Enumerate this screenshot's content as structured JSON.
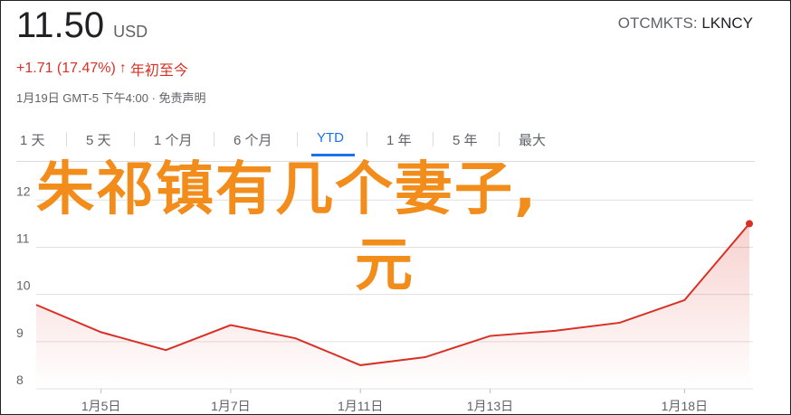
{
  "quote": {
    "price": "11.50",
    "currency": "USD",
    "exchange_label": "OTCMKTS:",
    "symbol": "LKNCY",
    "change": "+1.71 (17.47%)",
    "change_arrow": "↑",
    "change_period": "年初至今",
    "timestamp": "1月19日 GMT-5 下午4:00",
    "disclaimer": "免责声明",
    "meta_separator": "·"
  },
  "ranges": [
    "1 天",
    "5 天",
    "1 个月",
    "6 个月",
    "YTD",
    "1 年",
    "5 年",
    "最大"
  ],
  "active_range": "YTD",
  "overlay_text": {
    "line1": "朱祁镇有几个妻子,",
    "line2": "元"
  },
  "colors": {
    "line": "#d93025",
    "accent": "#1a73e8",
    "overlay": "#f28c1a"
  },
  "chart_data": {
    "type": "area",
    "x": [
      "1月4日",
      "1月5日",
      "1月6日",
      "1月7日",
      "1月8日",
      "1月11日",
      "1月12日",
      "1月13日",
      "1月14日",
      "1月15日",
      "1月18日",
      "1月19日"
    ],
    "values": [
      9.78,
      9.2,
      8.82,
      9.35,
      9.07,
      8.5,
      8.67,
      9.12,
      9.23,
      9.4,
      9.88,
      11.5
    ],
    "x_tick_labels": [
      "1月5日",
      "1月7日",
      "1月11日",
      "1月13日",
      "1月18日"
    ],
    "y_tick_labels": [
      "8",
      "9",
      "10",
      "11",
      "12"
    ],
    "ylim": [
      8,
      12.6
    ],
    "grid": true
  }
}
